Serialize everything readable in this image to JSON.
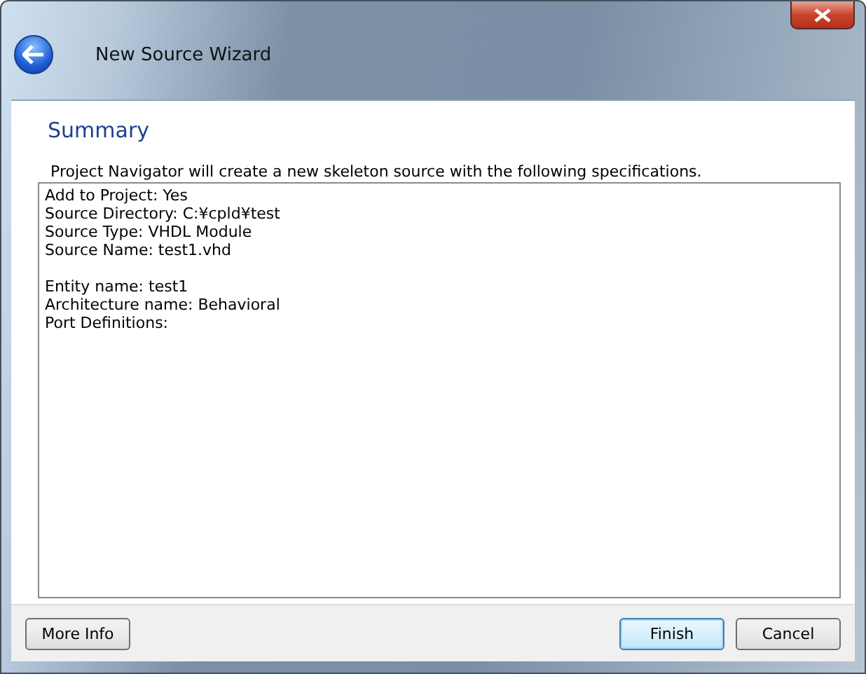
{
  "window": {
    "title": "New Source Wizard"
  },
  "page": {
    "heading": "Summary",
    "intro": "Project Navigator will create a new skeleton source with the following specifications."
  },
  "summary_groups": [
    [
      "Add to Project: Yes",
      "Source Directory: C:¥cpld¥test",
      "Source Type: VHDL Module",
      "Source Name: test1.vhd"
    ],
    [
      "Entity name: test1",
      "Architecture name: Behavioral",
      "Port Definitions:"
    ]
  ],
  "buttons": [
    {
      "label": "More Info",
      "kind": "left",
      "default": false
    },
    {
      "label": "Finish",
      "kind": "right",
      "default": true
    },
    {
      "label": "Cancel",
      "kind": "right",
      "default": false
    }
  ]
}
